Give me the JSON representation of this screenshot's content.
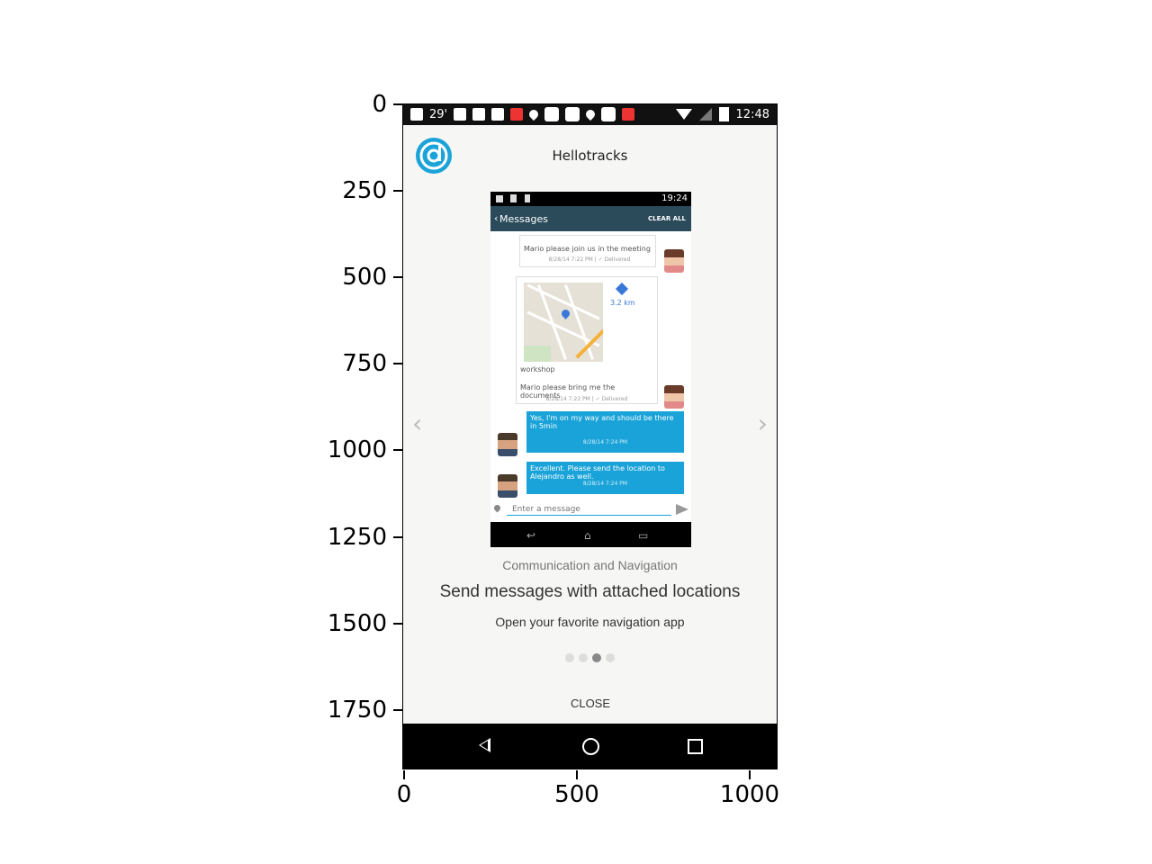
{
  "axes": {
    "y_ticks": [
      "0",
      "250",
      "500",
      "750",
      "1000",
      "1250",
      "1500",
      "1750"
    ],
    "x_ticks": [
      "0",
      "500",
      "1000"
    ]
  },
  "status_bar": {
    "temperature": "29'",
    "time": "12:48",
    "icons": [
      "message-icon",
      "facebook-icon",
      "facebook-icon",
      "facebook-icon",
      "pof-icon",
      "location-icon",
      "square-icon",
      "square-icon",
      "location-icon",
      "square-icon",
      "pof-icon",
      "wifi-icon",
      "signal-icon",
      "battery-icon"
    ]
  },
  "app": {
    "title": "Hellotracks",
    "brand_color": "#1aa3d8"
  },
  "screenshot": {
    "status_time": "19:24",
    "header_title": "Messages",
    "clear_all": "CLEAR ALL",
    "messages": [
      {
        "text": "Mario please join us in the meeting",
        "meta": "8/28/14 7:22 PM | ✓ Delivered"
      },
      {
        "distance": "3.2 km",
        "label": "workshop",
        "text": "Mario please bring me the documents",
        "meta": "8/28/14 7:22 PM | ✓ Delivered"
      },
      {
        "text": "Yes, I'm on my way and should be there in 5min",
        "meta": "8/28/14 7:24 PM"
      },
      {
        "text": "Excellent. Please send the location to Alejandro as well.",
        "meta": "8/28/14 7:24 PM"
      }
    ],
    "input_placeholder": "Enter a message"
  },
  "onboarding": {
    "subtitle": "Communication and Navigation",
    "title": "Send messages with attached locations",
    "description": "Open your favorite navigation app",
    "page_count": 4,
    "active_page": 3,
    "close_label": "CLOSE"
  }
}
